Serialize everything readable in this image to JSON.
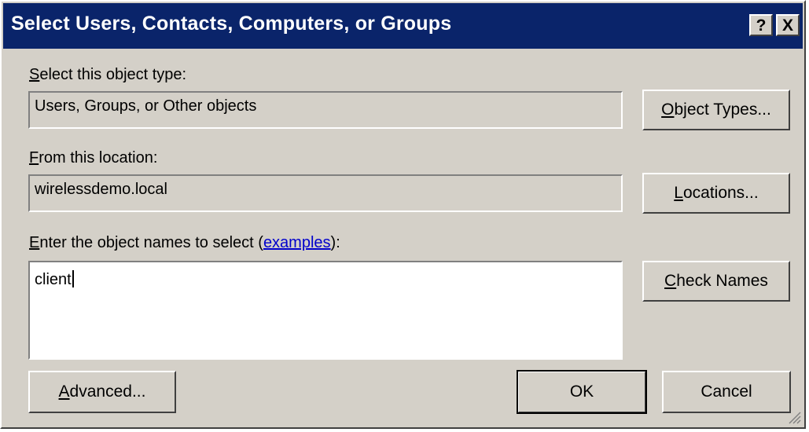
{
  "window": {
    "title": "Select Users, Contacts, Computers, or Groups",
    "help_label": "?",
    "close_label": "X"
  },
  "object_type": {
    "label_first": "S",
    "label_rest": "elect this object type:",
    "value": "Users, Groups, or Other objects",
    "button_first": "O",
    "button_rest": "bject Types..."
  },
  "location": {
    "label_first": "F",
    "label_rest": "rom this location:",
    "value": "wirelessdemo.local",
    "button_first": "L",
    "button_rest": "ocations..."
  },
  "names": {
    "label_first": "E",
    "label_rest": "nter the object names to select (",
    "link_text": "examples",
    "label_end": "):",
    "value": "client",
    "check_first": "C",
    "check_rest": "heck Names"
  },
  "footer": {
    "advanced_first": "A",
    "advanced_rest": "dvanced...",
    "ok_label": "OK",
    "cancel_label": "Cancel"
  }
}
